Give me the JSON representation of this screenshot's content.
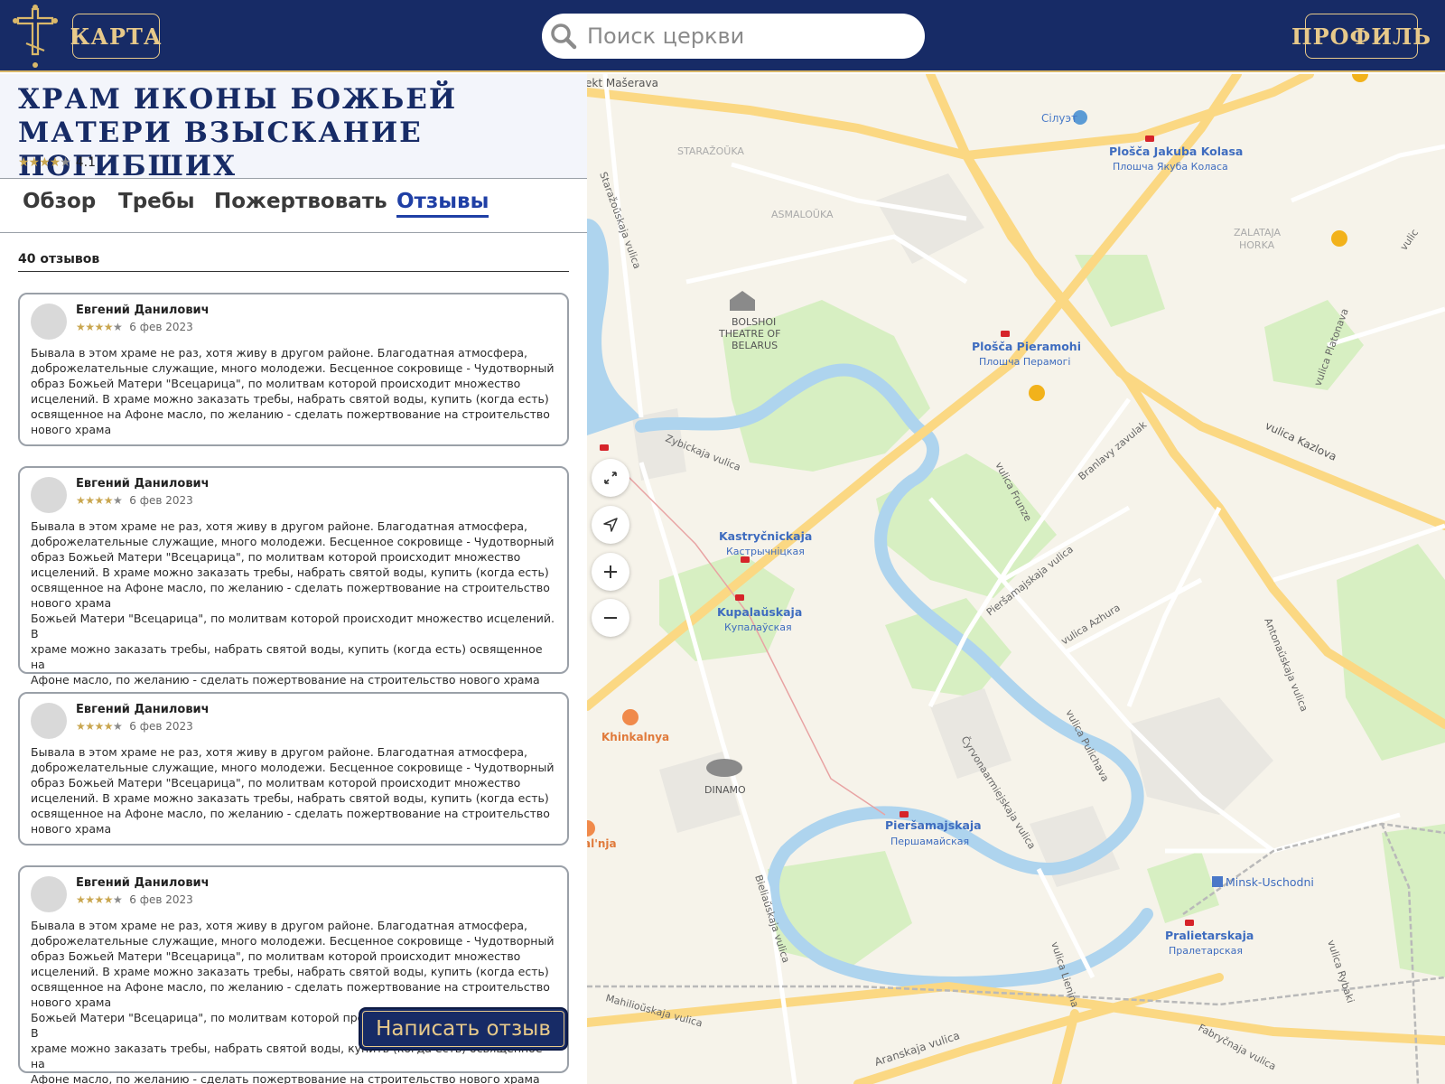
{
  "header": {
    "map_label": "КАРТА",
    "search_placeholder": "Поиск церкви",
    "profile_label": "ПРОФИЛЬ"
  },
  "church": {
    "title": "Храм иконы Божьей Матери Взыскание Погибших",
    "rating_value": "4.1",
    "rating_stars": 4
  },
  "tabs": [
    {
      "label": "Обзор",
      "active": false
    },
    {
      "label": "Требы",
      "active": false
    },
    {
      "label": "Пожертвовать",
      "active": false
    },
    {
      "label": "Отзывы",
      "active": true
    }
  ],
  "reviews_count_label": "40 отзывов",
  "reviews": [
    {
      "author": "Евгений Данилович",
      "stars": 4,
      "date": "6 фев 2023",
      "text": "Бывала в этом храме не раз, хотя живу в другом районе. Благодатная атмосфера,\nдоброжелательные служащие, много молодежи. Бесценное сокровище - Чудотворный\nобраз Божьей Матери \"Всецарица\", по молитвам которой происходит множество\nисцелений. В храме можно заказать требы, набрать святой воды, купить (когда есть)\nосвященное на Афоне масло, по желанию - сделать пожертвование на строительство\nнового храма"
    },
    {
      "author": "Евгений Данилович",
      "stars": 4,
      "date": "6 фев 2023",
      "text": "Бывала в этом храме не раз, хотя живу в другом районе. Благодатная атмосфера,\nдоброжелательные служащие, много молодежи. Бесценное сокровище - Чудотворный\nобраз Божьей Матери \"Всецарица\", по молитвам которой происходит множество\nисцелений. В храме можно заказать требы, набрать святой воды, купить (когда есть)\nосвященное на Афоне масло, по желанию - сделать пожертвование на строительство\nнового храма\n Божьей Матери \"Всецарица\", по молитвам которой происходит множество исцелений. В\nхраме можно заказать требы, набрать святой воды, купить (когда есть) освященное на\nАфоне масло, по желанию - сделать пожертвование на строительство нового храма"
    },
    {
      "author": "Евгений Данилович",
      "stars": 4,
      "date": "6 фев 2023",
      "text": "Бывала в этом храме не раз, хотя живу в другом районе. Благодатная атмосфера,\nдоброжелательные служащие, много молодежи. Бесценное сокровище - Чудотворный\nобраз Божьей Матери \"Всецарица\", по молитвам которой происходит множество\nисцелений. В храме можно заказать требы, набрать святой воды, купить (когда есть)\nосвященное на Афоне масло, по желанию - сделать пожертвование на строительство\nнового храма"
    },
    {
      "author": "Евгений Данилович",
      "stars": 4,
      "date": "6 фев 2023",
      "text": "Бывала в этом храме не раз, хотя живу в другом районе. Благодатная атмосфера,\nдоброжелательные служащие, много молодежи. Бесценное сокровище - Чудотворный\nобраз Божьей Матери \"Всецарица\", по молитвам которой происходит множество\nисцелений. В храме можно заказать требы, набрать святой воды, купить (когда есть)\nосвященное на Афоне масло, по желанию - сделать пожертвование на строительство\nнового храма\n Божьей Матери \"Всецарица\", по молитвам которой происходит множество исцелений. В\nхраме можно заказать требы, набрать святой воды, купить (когда есть) освященное на\nАфоне масло, по желанию - сделать пожертвование на строительство нового храма"
    }
  ],
  "write_review_label": "Написать отзыв",
  "map": {
    "labels": {
      "masherava": "ekt Mašerava",
      "silut": "Сілуэт",
      "kolasa": "Plošča Jakuba Kolasa",
      "kolasa_cyr": "Плошча Якуба Коласа",
      "starazouka": "STARAŽOŬKA",
      "asmalouka": "ASMALOŬKA",
      "zalataja": "ZALATAJA",
      "horka": "HORKA",
      "starazouskaja": "Staražoŭskaja vulica",
      "bolshoi1": "BOLSHOI",
      "bolshoi2": "THEATRE OF",
      "bolshoi3": "BELARUS",
      "pieramohi": "Plošča Pieramohi",
      "pieramohi_cyr": "Плошча Перамогі",
      "kazlova": "vulica Kazlova",
      "platonava": "vulica Platonava",
      "zybickaja": "Zybickaja vulica",
      "branlavy": "Branlavy zavulak",
      "frunze": "vulica Frunze",
      "kastrycnickaja": "Kastryčnickaja",
      "kastrycnickaja_cyr": "Кастрычніцкая",
      "kupalauskaja": "Kupalaŭskaja",
      "kupalauskaja_cyr": "Купалаўская",
      "piersamajskaja_v": "Pieršamajskaja vulica",
      "azhura": "vulica Azhura",
      "antonauskaja": "Antonaŭskaja vulica",
      "khinkalnya": "Khinkalnya",
      "dinamo": "DINAMO",
      "pulichava": "vulica Pulichava",
      "cyrvonaarmiejskaja": "Čyrvonaarmiejskaja vulica",
      "piersamajskaja": "Pieršamajskaja",
      "piersamajskaja_cyr": "Першамайская",
      "alnja": "al'nja",
      "uschodni": "Minsk-Uschodni",
      "pralietarskaja": "Pralietarskaja",
      "pralietarskaja_cyr": "Пралетарская",
      "bieliaskaja": "Bieliaŭskaja vulica",
      "lienina": "vulica Lienina",
      "rybaki": "vulica Rybaki",
      "mahilioskaja": "Mahilioŭskaja vulica",
      "aranskaja": "Aranskaja vulica",
      "fabrycnaja": "Fabryčnaja vulica",
      "vulic": "vulic"
    }
  }
}
